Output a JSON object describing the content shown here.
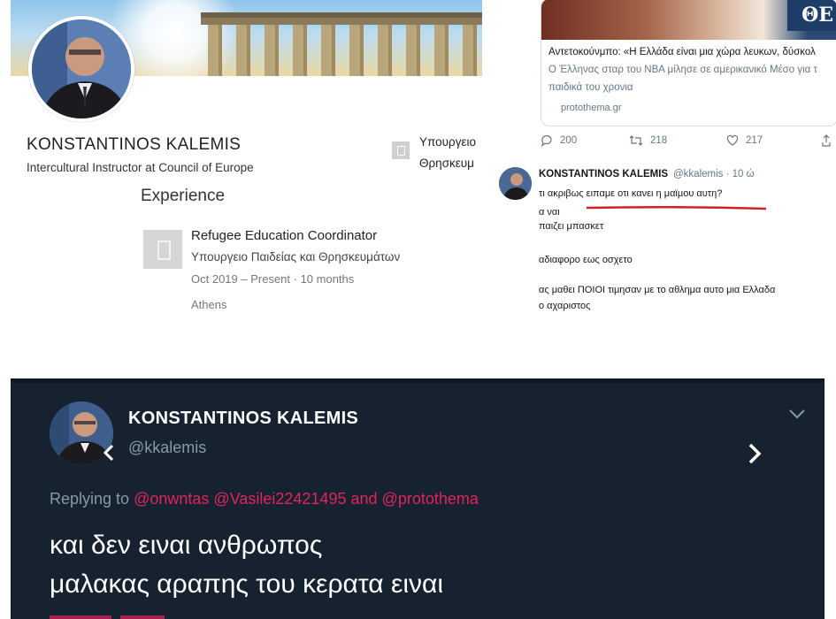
{
  "linkedin": {
    "name": "KONSTANTINOS KALEMIS",
    "headline": "Intercultural Instructor at Council of Europe",
    "side_org_line1": "Υπουργειο",
    "side_org_line2": "Θρησκευμ",
    "experience_heading": "Experience",
    "experience": {
      "title": "Refugee Education Coordinator",
      "organization": "Υπουργειο Παιδείας και Θρησκευμάτων",
      "dates": "Oct 2019 – Present · 10 months",
      "location": "Athens"
    }
  },
  "tweet_top": {
    "card": {
      "image_badge": "ΘΕ",
      "title": "Αντετοκούνμπο: «Η Ελλάδα είναι μια χώρα λευκων, δύσκολ",
      "description_line1": "Ο Έλληνας σταρ του NBA μίλησε σε αμερικανικό Μέσο για τ",
      "description_line2": "παιδικά του χρονια",
      "url": "protothema.gr"
    },
    "actions": {
      "replies": "200",
      "retweets": "218",
      "likes": "217"
    },
    "reply": {
      "name": "KONSTANTINOS KALEMIS",
      "handle": "@kkalemis · 10 ώ",
      "lines": [
        "τι ακριβως ειπαμε οτι κανει η μαϊμου αυτη?",
        "α ναι",
        "παιζει μπασκετ",
        "αδιαφορο εως οσχετο",
        "ας μαθει ΠΟΙΟΙ τιμησαν με το αθλημα αυτο μια Ελλαδα",
        "ο αχαριστος"
      ]
    }
  },
  "tweet_dark": {
    "name": "KONSTANTINOS KALEMIS",
    "handle": "@kkalemis",
    "replying_prefix": "Replying to",
    "mention1": "@onwntas",
    "mention2": "@Vasilei22421495",
    "and_word": "and",
    "mention3": "@protothema",
    "text_line1": "και δεν ειναι ανθρωπος",
    "text_line2": "μαλακας αραπης του κερατα ειναι"
  },
  "colors": {
    "dark_bg": "#162230",
    "mention": "#e0245e",
    "secondary_text": "#8899a6",
    "underline": "#d0212a"
  },
  "icons": [
    "reply-icon",
    "retweet-icon",
    "like-icon",
    "share-icon",
    "chevron-down-icon",
    "chevron-right-icon",
    "chevron-left-icon",
    "building-icon"
  ]
}
